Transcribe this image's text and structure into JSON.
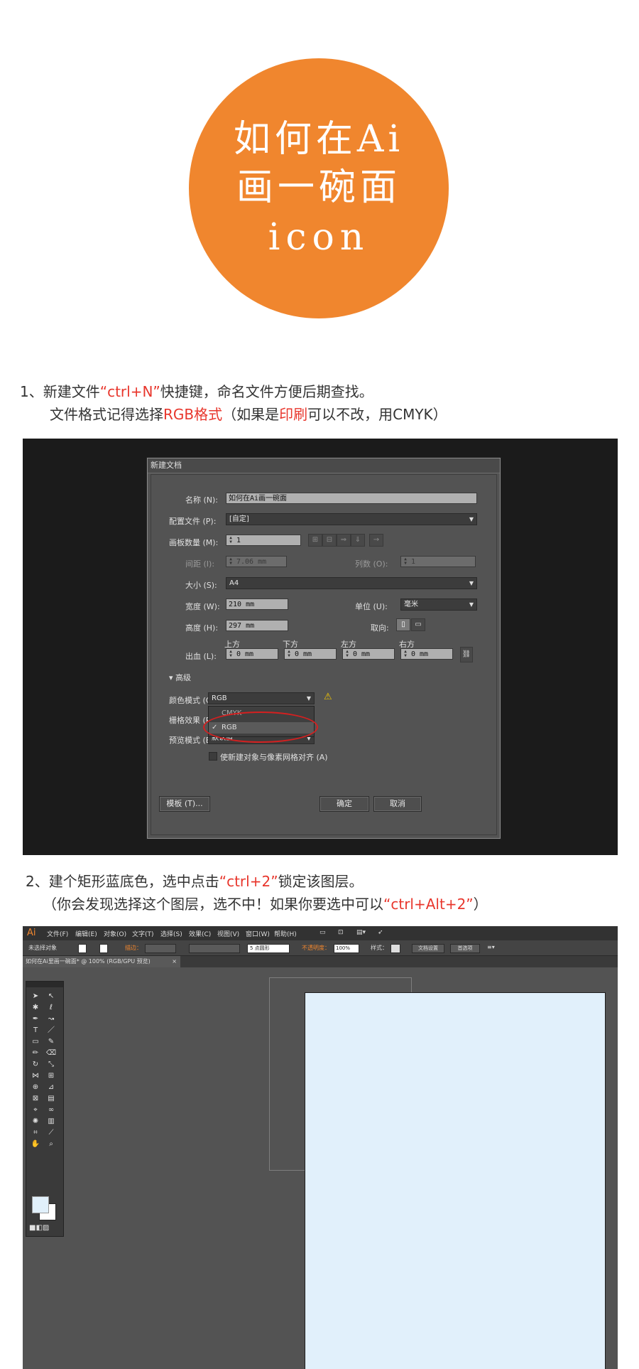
{
  "circle": {
    "lines": [
      "如何在Ai",
      "画一碗面",
      "icon"
    ],
    "color": "#f0862e"
  },
  "step1": {
    "line1_a": "1、新建文件",
    "line1_hl": "“ctrl+N”",
    "line1_b": "快捷键，命名文件方便后期查找。",
    "line2_a": "文件格式记得选择",
    "line2_hl": "RGB格式",
    "line2_b": "（如果是",
    "line2_hl2": "印刷",
    "line2_c": "可以不改，用CMYK）"
  },
  "dialog": {
    "title": "新建文档",
    "name_label": "名称 (N):",
    "name_value": "如何在Ai画一碗面",
    "profile_label": "配置文件 (P):",
    "profile_value": "[自定]",
    "artboards_label": "画板数量 (M):",
    "artboards_value": "1",
    "spacing_label": "间距 (I):",
    "spacing_value": "7.06 mm",
    "columns_label": "列数 (O):",
    "columns_value": "1",
    "size_label": "大小 (S):",
    "size_value": "A4",
    "width_label": "宽度 (W):",
    "width_value": "210 mm",
    "units_label": "单位 (U):",
    "units_value": "毫米",
    "height_label": "高度 (H):",
    "height_value": "297 mm",
    "orientation_label": "取向:",
    "bleed_label": "出血 (L):",
    "bleed_top_label": "上方",
    "bleed_bottom_label": "下方",
    "bleed_left_label": "左方",
    "bleed_right_label": "右方",
    "bleed_top": "0 mm",
    "bleed_bottom": "0 mm",
    "bleed_left": "0 mm",
    "bleed_right": "0 mm",
    "advanced_label": "高级",
    "color_mode_label": "颜色模式 (C):",
    "color_mode_value": "RGB",
    "raster_label": "栅格效果 (R):",
    "preview_label": "预览模式 (E):",
    "preview_value": "默认值",
    "menu_option_1": "CMYK",
    "menu_option_2": "RGB",
    "align_checkbox_label": "使新建对象与像素网格对齐 (A)",
    "templates_button": "模板 (T)...",
    "ok_button": "确定",
    "cancel_button": "取消"
  },
  "step2": {
    "line1_a": "2、建个矩形蓝底色，选中点击",
    "line1_hl": "“ctrl+2”",
    "line1_b": "锁定该图层。",
    "line2_a": "（你会发现选择这个图层，选不中！如果你要选中可以",
    "line2_hl": "“ctrl+Alt+2”",
    "line2_b": "）"
  },
  "app": {
    "logo": "Ai",
    "menus": [
      "文件(F)",
      "编辑(E)",
      "对象(O)",
      "文字(T)",
      "选择(S)",
      "效果(C)",
      "视图(V)",
      "窗口(W)",
      "帮助(H)"
    ],
    "no_selection": "未选择对象",
    "stroke_label": "描边：",
    "brush_value": "5 点圆形",
    "opacity_label": "不透明度：",
    "opacity_value": "100%",
    "style_label": "样式：",
    "doc_setup_button": "文档设置",
    "prefs_button": "首选项",
    "doc_tab": "如何在Ai里画一碗面* @ 100% (RGB/GPU 预览)",
    "tab_close": "×",
    "artboard_color": "#e1f0fb"
  }
}
